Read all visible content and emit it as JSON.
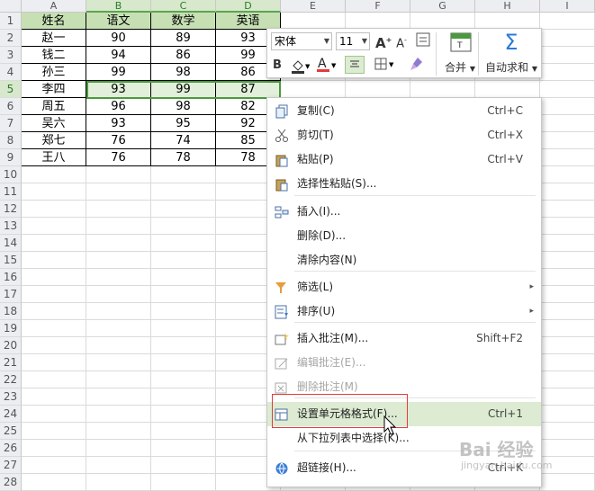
{
  "columns": [
    "A",
    "B",
    "C",
    "D",
    "E",
    "F",
    "G",
    "H",
    "I"
  ],
  "rows": [
    "1",
    "2",
    "3",
    "4",
    "5",
    "6",
    "7",
    "8",
    "9",
    "10",
    "11",
    "12",
    "13",
    "14",
    "15",
    "16",
    "17",
    "18",
    "19",
    "20",
    "21",
    "22",
    "23",
    "24",
    "25",
    "26",
    "27",
    "28"
  ],
  "table": {
    "headers": [
      "姓名",
      "语文",
      "数学",
      "英语"
    ],
    "data": [
      [
        "赵一",
        "90",
        "89",
        "93"
      ],
      [
        "钱二",
        "94",
        "86",
        "99"
      ],
      [
        "孙三",
        "99",
        "98",
        "86"
      ],
      [
        "李四",
        "93",
        "99",
        "87"
      ],
      [
        "周五",
        "96",
        "98",
        "82"
      ],
      [
        "吴六",
        "93",
        "95",
        "92"
      ],
      [
        "郑七",
        "76",
        "74",
        "85"
      ],
      [
        "王八",
        "76",
        "78",
        "78"
      ]
    ]
  },
  "mini_toolbar": {
    "font_name": "宋体",
    "font_size": "11",
    "merge_label": "合并",
    "autosum_label": "自动求和"
  },
  "context_menu": {
    "items": [
      {
        "label": "复制(C)",
        "shortcut": "Ctrl+C",
        "icon": "copy-icon",
        "disabled": false
      },
      {
        "label": "剪切(T)",
        "shortcut": "Ctrl+X",
        "icon": "scissors-icon",
        "disabled": false
      },
      {
        "label": "粘贴(P)",
        "shortcut": "Ctrl+V",
        "icon": "paste-icon",
        "disabled": false
      },
      {
        "label": "选择性粘贴(S)...",
        "shortcut": "",
        "icon": "paste-special-icon",
        "disabled": false
      },
      {
        "label": "插入(I)...",
        "shortcut": "",
        "icon": "insert-icon",
        "disabled": false
      },
      {
        "label": "删除(D)...",
        "shortcut": "",
        "icon": "",
        "disabled": false
      },
      {
        "label": "清除内容(N)",
        "shortcut": "",
        "icon": "",
        "disabled": false
      },
      {
        "label": "筛选(L)",
        "shortcut": "",
        "icon": "filter-icon",
        "disabled": false
      },
      {
        "label": "排序(U)",
        "shortcut": "",
        "icon": "sort-icon",
        "disabled": false
      },
      {
        "label": "插入批注(M)...",
        "shortcut": "Shift+F2",
        "icon": "insert-comment-icon",
        "disabled": false
      },
      {
        "label": "编辑批注(E)...",
        "shortcut": "",
        "icon": "edit-comment-icon",
        "disabled": true
      },
      {
        "label": "删除批注(M)",
        "shortcut": "",
        "icon": "delete-comment-icon",
        "disabled": true
      },
      {
        "label": "设置单元格格式(F)...",
        "shortcut": "Ctrl+1",
        "icon": "format-cells-icon",
        "disabled": false
      },
      {
        "label": "从下拉列表中选择(K)...",
        "shortcut": "",
        "icon": "",
        "disabled": false
      },
      {
        "label": "超链接(H)...",
        "shortcut": "Ctrl+K",
        "icon": "hyperlink-icon",
        "disabled": false
      }
    ]
  },
  "watermark": {
    "brand": "Bai 经验",
    "url": "jingyan.baidu.com"
  },
  "colors": {
    "accent_green": "#4a9a3e",
    "header_fill": "#c6e0b4",
    "highlight": "#dcebd2",
    "red_annotation": "#e23c3c"
  }
}
